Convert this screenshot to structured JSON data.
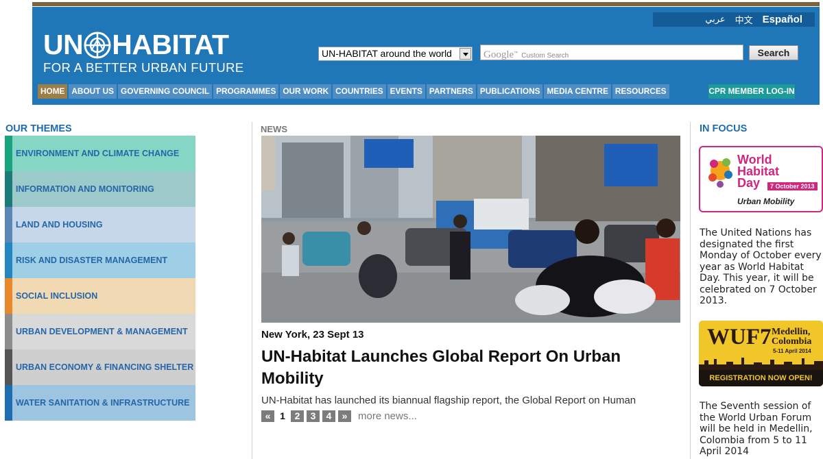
{
  "header": {
    "logo_main_left": "UN",
    "logo_main_right": "HABITAT",
    "logo_tagline": "FOR A BETTER URBAN FUTURE",
    "languages": [
      "عربي",
      "中文",
      "Español"
    ],
    "site_select": "UN-HABITAT around the world",
    "search_brand": "Google",
    "search_placeholder": "Custom Search",
    "search_button": "Search"
  },
  "nav": {
    "items": [
      "HOME",
      "ABOUT US",
      "GOVERNING COUNCIL",
      "PROGRAMMES",
      "OUR WORK",
      "COUNTRIES",
      "EVENTS",
      "PARTNERS",
      "PUBLICATIONS",
      "MEDIA CENTRE",
      "RESOURCES"
    ],
    "cpr": "CPR MEMBER LOG-IN"
  },
  "themes": {
    "label": "OUR THEMES",
    "items": [
      {
        "label": "ENVIRONMENT AND CLIMATE CHANGE",
        "bg": "#86d6c6",
        "bar": "#1aa37f"
      },
      {
        "label": "INFORMATION AND MONITORING",
        "bg": "#9cc9c9",
        "bar": "#1c7a78"
      },
      {
        "label": "LAND AND HOUSING",
        "bg": "#c6d7ea",
        "bar": "#5b86b5"
      },
      {
        "label": "RISK AND DISASTER MANAGEMENT",
        "bg": "#9fcfe6",
        "bar": "#2486c1"
      },
      {
        "label": "SOCIAL INCLUSION",
        "bg": "#f1d9b4",
        "bar": "#e7882d"
      },
      {
        "label": "URBAN DEVELOPMENT & MANAGEMENT",
        "bg": "#d9d9d9",
        "bar": "#8d8d8d"
      },
      {
        "label": "URBAN ECONOMY & FINANCING SHELTER",
        "bg": "#cfcfcf",
        "bar": "#555555"
      },
      {
        "label": "WATER SANITATION & INFRASTRUCTURE",
        "bg": "#9dc5e2",
        "bar": "#1f6db1"
      }
    ]
  },
  "news": {
    "label": "NEWS",
    "date": "New York, 23 Sept 13",
    "title": "UN-Habitat Launches Global Report On Urban Mobility",
    "teaser": "UN-Habitat has launched its biannual flagship report, the Global Report on Human",
    "pager": {
      "prev": "«",
      "pages": [
        "1",
        "2",
        "3",
        "4"
      ],
      "next": "»",
      "current": "1"
    },
    "more": "more news..."
  },
  "focus": {
    "label": "IN FOCUS",
    "whd_line1": "World",
    "whd_line2": "Habitat",
    "whd_line3": "Day",
    "whd_date": "7 October 2013",
    "whd_sub": "Urban Mobility",
    "whd_text": "The United Nations has designated the first Monday of October every year as World Habitat Day. This year, it will be celebrated on 7 October 2013.",
    "wuf_title": "WUF7",
    "wuf_city": "Medellin,",
    "wuf_country": "Colombia",
    "wuf_dates": "5-11 April 2014",
    "wuf_reg": "REGISTRATION NOW OPEN!",
    "wuf_text": "The Seventh session of the World Urban Forum will be held in Medellin, Colombia from 5 to 11 April 2014"
  },
  "colors": {
    "header_blue": "#1f77b8",
    "nav_blue": "#4f8ec4",
    "nav_active": "#9c7e47",
    "cpr_teal": "#1d9b9b",
    "label_blue": "#1f6aab",
    "whd_pink": "#d0267d",
    "wuf_yellow": "#f1c628"
  }
}
